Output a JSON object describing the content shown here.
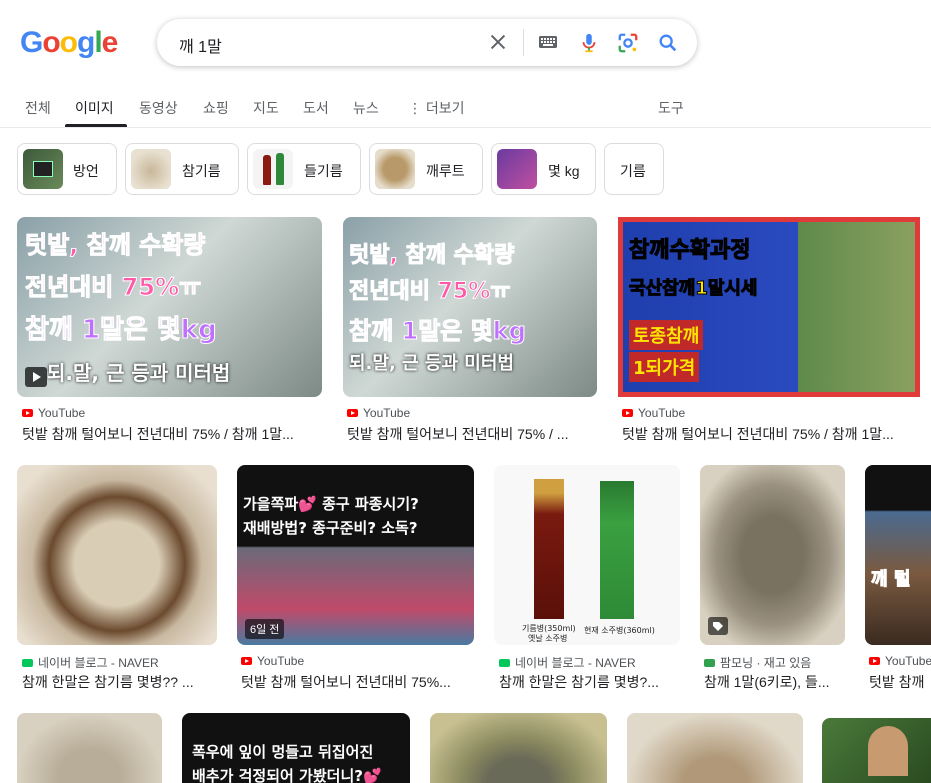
{
  "logo": {
    "text": "Google"
  },
  "search": {
    "query": "깨 1말"
  },
  "tabs": [
    "전체",
    "이미지",
    "동영상",
    "쇼핑",
    "지도",
    "도서",
    "뉴스",
    "더보기",
    "도구"
  ],
  "chips": [
    "방언",
    "참기름",
    "들기름",
    "깨루트",
    "몇 kg",
    "기름"
  ],
  "results_row1": [
    {
      "source": "YouTube",
      "title": "텃밭 참깨 털어보니 전년대비 75% / 참깨 1말...",
      "thumb": [
        "텃밭, 참깨 수확량",
        "전년대비 75%ㅠ",
        "참깨 1말은 몇kg",
        "되.말, 근 등과 미터법"
      ]
    },
    {
      "source": "YouTube",
      "title": "텃밭 참깨 털어보니 전년대비 75% / ...",
      "thumb": [
        "텃밭, 참깨 수확량",
        "전년대비 75%ㅠ",
        "참깨 1말은 몇kg",
        "되.말, 근 등과 미터법"
      ]
    },
    {
      "source": "YouTube",
      "title": "텃밭 참깨 털어보니 전년대비 75% / 참깨 1말...",
      "thumb": [
        "참깨수확과정",
        "국산참깨1말시세",
        "토종참깨",
        "1되가격"
      ]
    }
  ],
  "results_row2": [
    {
      "source": "네이버 블로그 - NAVER",
      "title": "참깨 한말은 참기름 몇병?? ..."
    },
    {
      "source": "YouTube",
      "title": "텃밭 참깨 털어보니 전년대비 75%...",
      "badge": "6일 전",
      "thumb": [
        "가을쪽파💕 종구 파종시기?",
        "재배방법? 종구준비? 소독?"
      ]
    },
    {
      "source": "네이버 블로그 - NAVER",
      "title": "참깨 한말은 참기름 몇병?...",
      "thumb": [
        "기름병(350ml)",
        "옛날 소주병",
        "현재 소주병(360ml)"
      ]
    },
    {
      "source": "팜모닝 · 재고 있음",
      "title": "참깨 1말(6키로), 들..."
    },
    {
      "source": "YouTube",
      "title": "텃밭 참깨",
      "thumb": [
        "깨 털"
      ]
    }
  ],
  "results_row3": [
    {
      "thumb": [
        "폭우에 잎이 멍들고 뒤집어진",
        "배추가 걱정되어 가봤더니?💕"
      ]
    }
  ]
}
